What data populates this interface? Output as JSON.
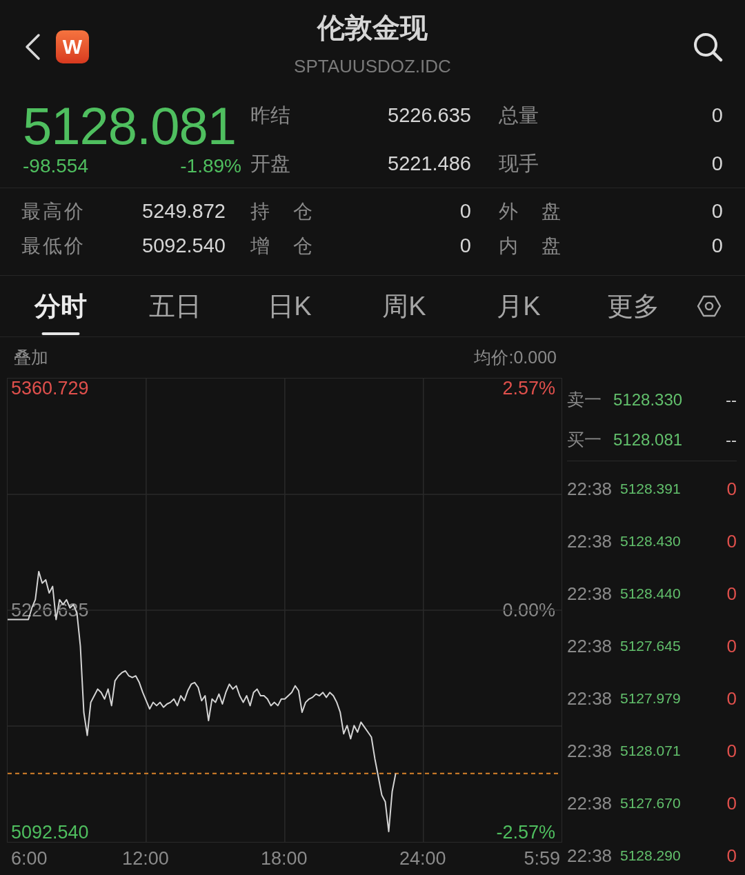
{
  "header": {
    "title": "伦敦金现",
    "subtitle": "SPTAUUSDOZ.IDC",
    "logo_text": "W"
  },
  "quote": {
    "price": "5128.081",
    "change": "-98.554",
    "change_percent": "-1.89%",
    "falling": true,
    "rows": [
      {
        "items": [
          {
            "label": "昨结",
            "value": "5226.635"
          },
          {
            "label": "总量",
            "value": "0"
          }
        ]
      },
      {
        "items": [
          {
            "label": "开盘",
            "value": "5221.486"
          },
          {
            "label": "现手",
            "value": "0"
          }
        ]
      }
    ]
  },
  "stats": {
    "rows": [
      {
        "items": [
          {
            "label": "最高价",
            "value": "5249.872"
          },
          {
            "label": "持 仓",
            "value": "0"
          },
          {
            "label": "外 盘",
            "value": "0"
          }
        ]
      },
      {
        "items": [
          {
            "label": "最低价",
            "value": "5092.540"
          },
          {
            "label": "增 仓",
            "value": "0"
          },
          {
            "label": "内 盘",
            "value": "0"
          }
        ]
      }
    ]
  },
  "tabs": [
    {
      "label": "分时",
      "selected": true
    },
    {
      "label": "五日",
      "selected": false
    },
    {
      "label": "日K",
      "selected": false
    },
    {
      "label": "周K",
      "selected": false
    },
    {
      "label": "月K",
      "selected": false
    },
    {
      "label": "更多",
      "selected": false
    }
  ],
  "chart": {
    "overlay_label": "叠加",
    "average_price": "均价:0.000",
    "percent_labels": [
      "2.57%",
      "0.00%",
      "-2.57%"
    ],
    "session_end_label": "5:59",
    "chart_data": {
      "type": "line",
      "grid": true,
      "xlim": [
        6,
        29.98
      ],
      "ylim": [
        5086.71,
        5366.56
      ],
      "xticks": [
        {
          "value": 6,
          "label": "6:00"
        },
        {
          "value": 12,
          "label": "12:00"
        },
        {
          "value": 18,
          "label": "18:00"
        },
        {
          "value": 24,
          "label": "24:00"
        }
      ],
      "yticks": [
        {
          "value": 5360.729,
          "label": "5360.729"
        },
        {
          "value": 5226.635,
          "label": "5226.635"
        },
        {
          "value": 5092.54,
          "label": "5092.540"
        }
      ],
      "ref_lines": [
        {
          "axis": "y",
          "value": 5128.081
        }
      ],
      "x": [
        6,
        6.15,
        6.3,
        6.45,
        6.6,
        6.75,
        6.9,
        7.05,
        7.2,
        7.35,
        7.5,
        7.65,
        7.8,
        7.95,
        8.1,
        8.25,
        8.4,
        8.55,
        8.7,
        8.85,
        9,
        9.15,
        9.3,
        9.45,
        9.6,
        9.75,
        9.9,
        10.05,
        10.2,
        10.35,
        10.5,
        10.65,
        10.8,
        10.95,
        11.1,
        11.25,
        11.4,
        11.55,
        11.7,
        11.85,
        12,
        12.15,
        12.3,
        12.45,
        12.6,
        12.75,
        12.9,
        13.05,
        13.2,
        13.35,
        13.5,
        13.65,
        13.8,
        13.95,
        14.1,
        14.25,
        14.4,
        14.55,
        14.7,
        14.85,
        15,
        15.15,
        15.3,
        15.45,
        15.6,
        15.75,
        15.9,
        16.05,
        16.2,
        16.35,
        16.5,
        16.65,
        16.8,
        16.95,
        17.1,
        17.25,
        17.4,
        17.55,
        17.7,
        17.85,
        18,
        18.15,
        18.3,
        18.45,
        18.6,
        18.75,
        18.9,
        19.05,
        19.2,
        19.35,
        19.5,
        19.65,
        19.8,
        19.95,
        20.1,
        20.25,
        20.4,
        20.55,
        20.7,
        20.85,
        21,
        21.15,
        21.3,
        21.45,
        21.6,
        21.75,
        21.9,
        22.05,
        22.2,
        22.35,
        22.5,
        22.65,
        22.8
      ],
      "series": [
        {
          "values": [
            5221,
            5221,
            5221,
            5221,
            5221,
            5221,
            5221,
            5228,
            5233,
            5250,
            5243,
            5245,
            5237,
            5241,
            5221,
            5233,
            5230,
            5233,
            5228,
            5230,
            5225,
            5205,
            5165,
            5151,
            5171,
            5175,
            5179,
            5177,
            5173,
            5179,
            5169,
            5184,
            5187,
            5189,
            5190,
            5187,
            5186,
            5187,
            5183,
            5177,
            5172,
            5167,
            5171,
            5169,
            5171,
            5168,
            5170,
            5171,
            5173,
            5169,
            5175,
            5172,
            5178,
            5182,
            5183,
            5180,
            5172,
            5175,
            5160,
            5173,
            5171,
            5176,
            5170,
            5177,
            5182,
            5179,
            5181,
            5175,
            5171,
            5175,
            5169,
            5177,
            5179,
            5175,
            5175,
            5173,
            5169,
            5171,
            5169,
            5173,
            5173,
            5175,
            5177,
            5181,
            5178,
            5165,
            5171,
            5173,
            5174,
            5176,
            5175,
            5177,
            5174,
            5177,
            5175,
            5171,
            5165,
            5152,
            5157,
            5149,
            5157,
            5153,
            5159,
            5156,
            5153,
            5150,
            5137,
            5126,
            5115,
            5111,
            5093,
            5117,
            5128
          ]
        }
      ]
    }
  },
  "order_book": [
    {
      "label": "卖一",
      "price": "5128.330",
      "volume": "--"
    },
    {
      "label": "买一",
      "price": "5128.081",
      "volume": "--"
    }
  ],
  "trades": [
    {
      "time": "22:38",
      "price": "5128.391",
      "volume": "0"
    },
    {
      "time": "22:38",
      "price": "5128.430",
      "volume": "0"
    },
    {
      "time": "22:38",
      "price": "5128.440",
      "volume": "0"
    },
    {
      "time": "22:38",
      "price": "5127.645",
      "volume": "0"
    },
    {
      "time": "22:38",
      "price": "5127.979",
      "volume": "0"
    },
    {
      "time": "22:38",
      "price": "5128.071",
      "volume": "0"
    },
    {
      "time": "22:38",
      "price": "5127.670",
      "volume": "0"
    },
    {
      "time": "22:38",
      "price": "5128.290",
      "volume": "0"
    }
  ]
}
